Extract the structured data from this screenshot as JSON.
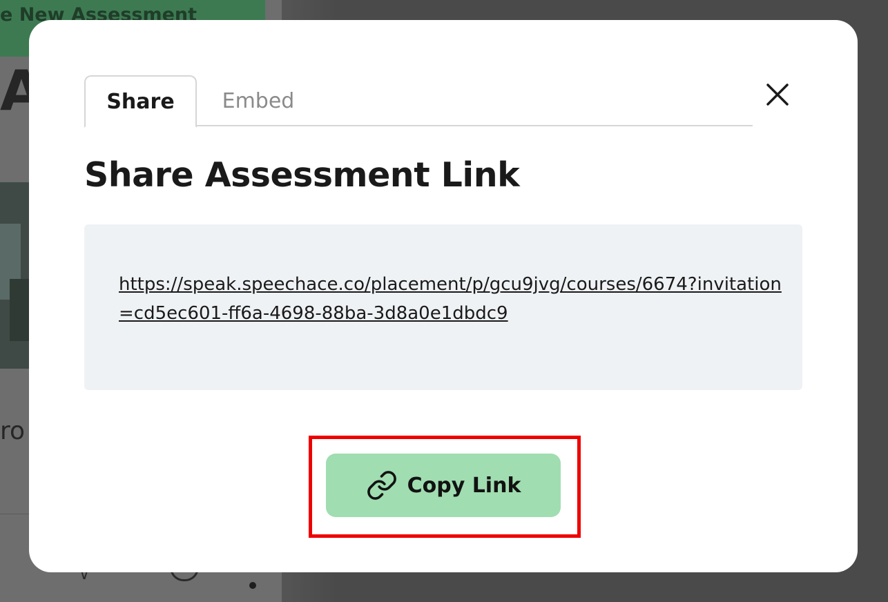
{
  "background": {
    "banner_text": "e New Assessment",
    "heading_fragment": "As",
    "text_fragment": "ro"
  },
  "modal": {
    "tabs": [
      {
        "label": "Share",
        "active": true
      },
      {
        "label": "Embed",
        "active": false
      }
    ],
    "close_icon": "close-icon",
    "title": "Share Assessment Link",
    "share_link": "https://speak.speechace.co/placement/p/gcu9jvg/courses/6674?invitation=cd5ec601-ff6a-4698-88ba-3d8a0e1dbdc9",
    "copy_button": {
      "label": "Copy Link",
      "icon": "link-icon",
      "color": "#a0ddb0"
    },
    "highlight_color": "#ee0000"
  }
}
